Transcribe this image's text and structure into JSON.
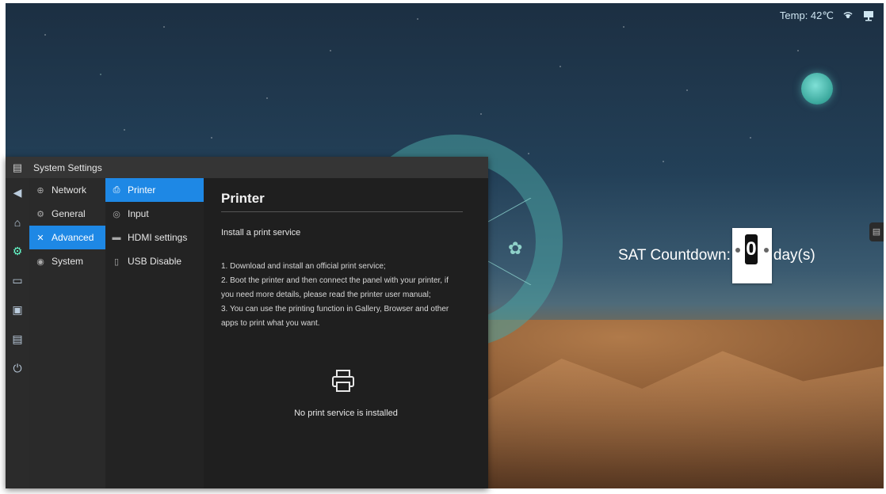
{
  "status_bar": {
    "temp": "Temp: 42℃",
    "icons": [
      "wifi-icon",
      "display-icon"
    ]
  },
  "countdown": {
    "label": "SAT Countdown:",
    "value": "0",
    "unit": "day(s)"
  },
  "window": {
    "title": "System Settings",
    "menu": [
      {
        "label": "Network",
        "icon": "globe-icon",
        "active": false
      },
      {
        "label": "General",
        "icon": "gear-icon",
        "active": false
      },
      {
        "label": "Advanced",
        "icon": "tools-icon",
        "active": true
      },
      {
        "label": "System",
        "icon": "info-icon",
        "active": false
      }
    ],
    "submenu": [
      {
        "label": "Printer",
        "icon": "printer-icon",
        "active": true
      },
      {
        "label": "Input",
        "icon": "input-icon",
        "active": false
      },
      {
        "label": "HDMI settings",
        "icon": "hdmi-icon",
        "active": false
      },
      {
        "label": "USB Disable",
        "icon": "usb-icon",
        "active": false
      }
    ],
    "content": {
      "title": "Printer",
      "subtitle": "Install a print service",
      "steps": [
        "1. Download and install an official print service;",
        "2. Boot the printer and then connect the panel with your printer, if",
        "you need more details, please read the printer user manual;",
        "3. You can use the printing function in Gallery, Browser and other",
        "apps to print what you want."
      ],
      "empty_message": "No print service is installed"
    }
  },
  "dock_icons": [
    "back-icon",
    "home-icon",
    "settings-icon",
    "folder-icon",
    "screen-icon",
    "display-icon",
    "power-icon"
  ]
}
